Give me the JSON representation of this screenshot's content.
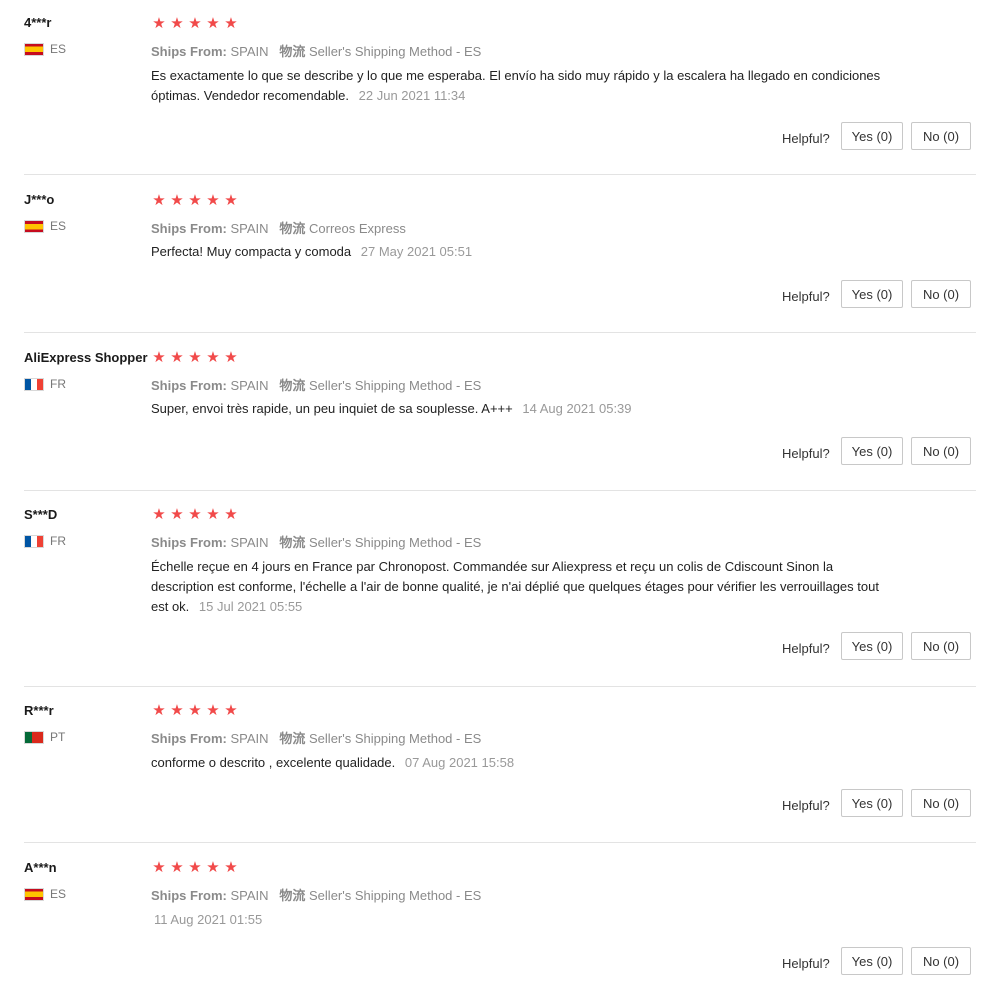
{
  "labels": {
    "ships_from": "Ships From:",
    "logistics": "物流",
    "helpful": "Helpful?"
  },
  "colors": {
    "star": "#f14a4a",
    "divider": "#e3e3e3"
  },
  "reviews": [
    {
      "user": "4***r",
      "country": "ES",
      "flag_icon": "spain-flag-icon",
      "stars": 5,
      "ships_from": "SPAIN",
      "shipping_method": "Seller's Shipping Method - ES",
      "text": "Es exactamente lo que se describe y lo que me esperaba. El envío ha sido muy rápido y la escalera ha llegado en condiciones óptimas. Vendedor recomendable.",
      "date": "22 Jun 2021 11:34",
      "yes": "Yes (0)",
      "no": "No (0)"
    },
    {
      "user": "J***o",
      "country": "ES",
      "flag_icon": "spain-flag-icon",
      "stars": 5,
      "ships_from": "SPAIN",
      "shipping_method": "Correos Express",
      "text": "Perfecta! Muy compacta y comoda",
      "date": "27 May 2021 05:51",
      "yes": "Yes (0)",
      "no": "No (0)"
    },
    {
      "user": "AliExpress Shopper",
      "country": "FR",
      "flag_icon": "france-flag-icon",
      "stars": 5,
      "ships_from": "SPAIN",
      "shipping_method": "Seller's Shipping Method - ES",
      "text": "Super, envoi très rapide, un peu inquiet de sa souplesse. A+++",
      "date": "14 Aug 2021 05:39",
      "yes": "Yes (0)",
      "no": "No (0)"
    },
    {
      "user": "S***D",
      "country": "FR",
      "flag_icon": "france-flag-icon",
      "stars": 5,
      "ships_from": "SPAIN",
      "shipping_method": "Seller's Shipping Method - ES",
      "text": "Échelle reçue en 4 jours en France par Chronopost. Commandée sur Aliexpress et reçu un colis de Cdiscount Sinon la description est conforme, l'échelle a l'air de bonne qualité, je n'ai déplié que quelques étages pour vérifier les verrouillages tout est ok.",
      "date": "15 Jul 2021 05:55",
      "yes": "Yes (0)",
      "no": "No (0)"
    },
    {
      "user": "R***r",
      "country": "PT",
      "flag_icon": "portugal-flag-icon",
      "stars": 5,
      "ships_from": "SPAIN",
      "shipping_method": "Seller's Shipping Method - ES",
      "text": "conforme o descrito , excelente qualidade.",
      "date": "07 Aug 2021 15:58",
      "yes": "Yes (0)",
      "no": "No (0)"
    },
    {
      "user": "A***n",
      "country": "ES",
      "flag_icon": "spain-flag-icon",
      "stars": 5,
      "ships_from": "SPAIN",
      "shipping_method": "Seller's Shipping Method - ES",
      "text": "",
      "date": "11 Aug 2021 01:55",
      "yes": "Yes (0)",
      "no": "No (0)"
    }
  ]
}
